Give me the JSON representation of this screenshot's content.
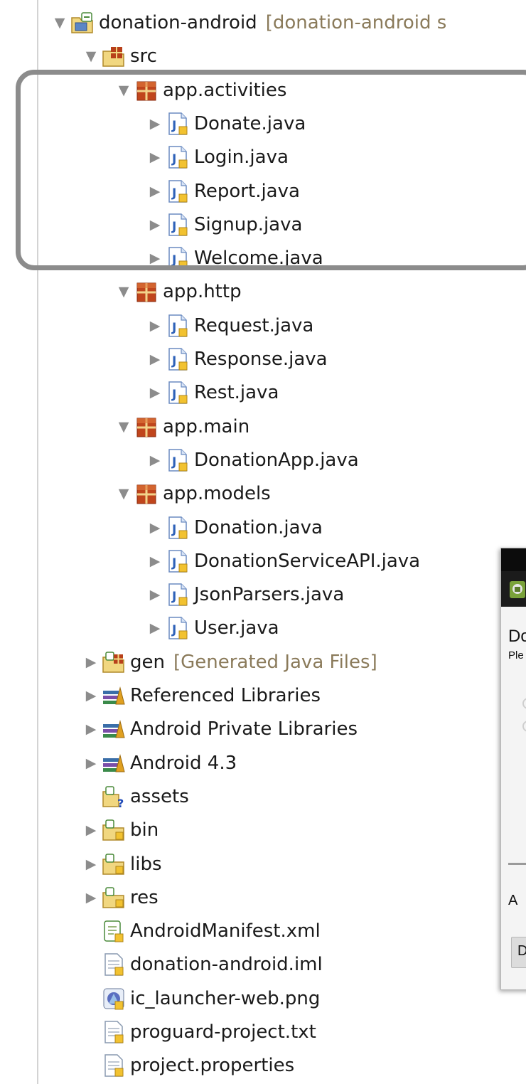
{
  "tree": {
    "nodes": [
      {
        "id": "project",
        "depth": 0,
        "label": "donation-android",
        "decoration": "[donation-android s",
        "arrow": "▼",
        "icon": "project-folder-icon",
        "kind": "project-folder"
      },
      {
        "id": "src",
        "depth": 1,
        "label": "src",
        "arrow": "▼",
        "icon": "source-folder-icon",
        "kind": "source-folder"
      },
      {
        "id": "pkg-activities",
        "depth": 2,
        "label": "app.activities",
        "arrow": "▼",
        "icon": "package-icon",
        "kind": "package"
      },
      {
        "id": "donate",
        "depth": 3,
        "label": "Donate.java",
        "arrow": "▶",
        "icon": "java-file-icon",
        "kind": "java"
      },
      {
        "id": "login",
        "depth": 3,
        "label": "Login.java",
        "arrow": "▶",
        "icon": "java-file-icon",
        "kind": "java"
      },
      {
        "id": "report",
        "depth": 3,
        "label": "Report.java",
        "arrow": "▶",
        "icon": "java-file-icon",
        "kind": "java"
      },
      {
        "id": "signup",
        "depth": 3,
        "label": "Signup.java",
        "arrow": "▶",
        "icon": "java-file-icon",
        "kind": "java"
      },
      {
        "id": "welcome",
        "depth": 3,
        "label": "Welcome.java",
        "arrow": "▶",
        "icon": "java-file-icon",
        "kind": "java"
      },
      {
        "id": "pkg-http",
        "depth": 2,
        "label": "app.http",
        "arrow": "▼",
        "icon": "package-icon",
        "kind": "package"
      },
      {
        "id": "request",
        "depth": 3,
        "label": "Request.java",
        "arrow": "▶",
        "icon": "java-file-icon",
        "kind": "java"
      },
      {
        "id": "response",
        "depth": 3,
        "label": "Response.java",
        "arrow": "▶",
        "icon": "java-file-icon",
        "kind": "java"
      },
      {
        "id": "rest",
        "depth": 3,
        "label": "Rest.java",
        "arrow": "▶",
        "icon": "java-file-icon",
        "kind": "java"
      },
      {
        "id": "pkg-main",
        "depth": 2,
        "label": "app.main",
        "arrow": "▼",
        "icon": "package-icon",
        "kind": "package"
      },
      {
        "id": "donationapp",
        "depth": 3,
        "label": "DonationApp.java",
        "arrow": "▶",
        "icon": "java-file-icon",
        "kind": "java"
      },
      {
        "id": "pkg-models",
        "depth": 2,
        "label": "app.models",
        "arrow": "▼",
        "icon": "package-icon",
        "kind": "package"
      },
      {
        "id": "donation",
        "depth": 3,
        "label": "Donation.java",
        "arrow": "▶",
        "icon": "java-file-icon",
        "kind": "java"
      },
      {
        "id": "donationserviceapi",
        "depth": 3,
        "label": "DonationServiceAPI.java",
        "arrow": "▶",
        "icon": "java-file-icon",
        "kind": "java"
      },
      {
        "id": "jsonparsers",
        "depth": 3,
        "label": "JsonParsers.java",
        "arrow": "▶",
        "icon": "java-file-icon",
        "kind": "java"
      },
      {
        "id": "user",
        "depth": 3,
        "label": "User.java",
        "arrow": "▶",
        "icon": "java-file-icon",
        "kind": "java"
      },
      {
        "id": "gen",
        "depth": 1,
        "label": "gen",
        "decoration": "[Generated Java Files]",
        "arrow": "▶",
        "icon": "generated-folder-icon",
        "kind": "gen-folder"
      },
      {
        "id": "referenced-libraries",
        "depth": 1,
        "label": "Referenced Libraries",
        "arrow": "▶",
        "icon": "library-icon",
        "kind": "library"
      },
      {
        "id": "android-private-libraries",
        "depth": 1,
        "label": "Android Private Libraries",
        "arrow": "▶",
        "icon": "library-icon",
        "kind": "library"
      },
      {
        "id": "android-43",
        "depth": 1,
        "label": "Android 4.3",
        "arrow": "▶",
        "icon": "library-icon",
        "kind": "library"
      },
      {
        "id": "assets",
        "depth": 1,
        "label": "assets",
        "arrow": "",
        "icon": "assets-folder-icon",
        "kind": "assets"
      },
      {
        "id": "bin",
        "depth": 1,
        "label": "bin",
        "arrow": "▶",
        "icon": "folder-icon",
        "kind": "folder"
      },
      {
        "id": "libs",
        "depth": 1,
        "label": "libs",
        "arrow": "▶",
        "icon": "folder-icon",
        "kind": "folder"
      },
      {
        "id": "res",
        "depth": 1,
        "label": "res",
        "arrow": "▶",
        "icon": "folder-icon",
        "kind": "folder"
      },
      {
        "id": "androidmanifest",
        "depth": 1,
        "label": "AndroidManifest.xml",
        "arrow": "",
        "icon": "manifest-icon",
        "kind": "manifest"
      },
      {
        "id": "iml",
        "depth": 1,
        "label": "donation-android.iml",
        "arrow": "",
        "icon": "text-file-icon",
        "kind": "file"
      },
      {
        "id": "ic-launcher",
        "depth": 1,
        "label": "ic_launcher-web.png",
        "arrow": "",
        "icon": "image-file-icon",
        "kind": "image"
      },
      {
        "id": "proguard",
        "depth": 1,
        "label": "proguard-project.txt",
        "arrow": "",
        "icon": "text-file-icon",
        "kind": "file"
      },
      {
        "id": "project-properties",
        "depth": 1,
        "label": "project.properties",
        "arrow": "",
        "icon": "text-file-icon",
        "kind": "file"
      }
    ]
  },
  "emulator": {
    "title_text": "Do",
    "subtitle_text": "Ple",
    "amount_text": "A",
    "button_text": "D"
  },
  "colors": {
    "arrow": "#8c8c8c",
    "highlight_border": "#8c8c8c",
    "decoration_text": "#8a7a5a",
    "package_icon": "#b8401a",
    "java_icon": "#2f62b8"
  }
}
